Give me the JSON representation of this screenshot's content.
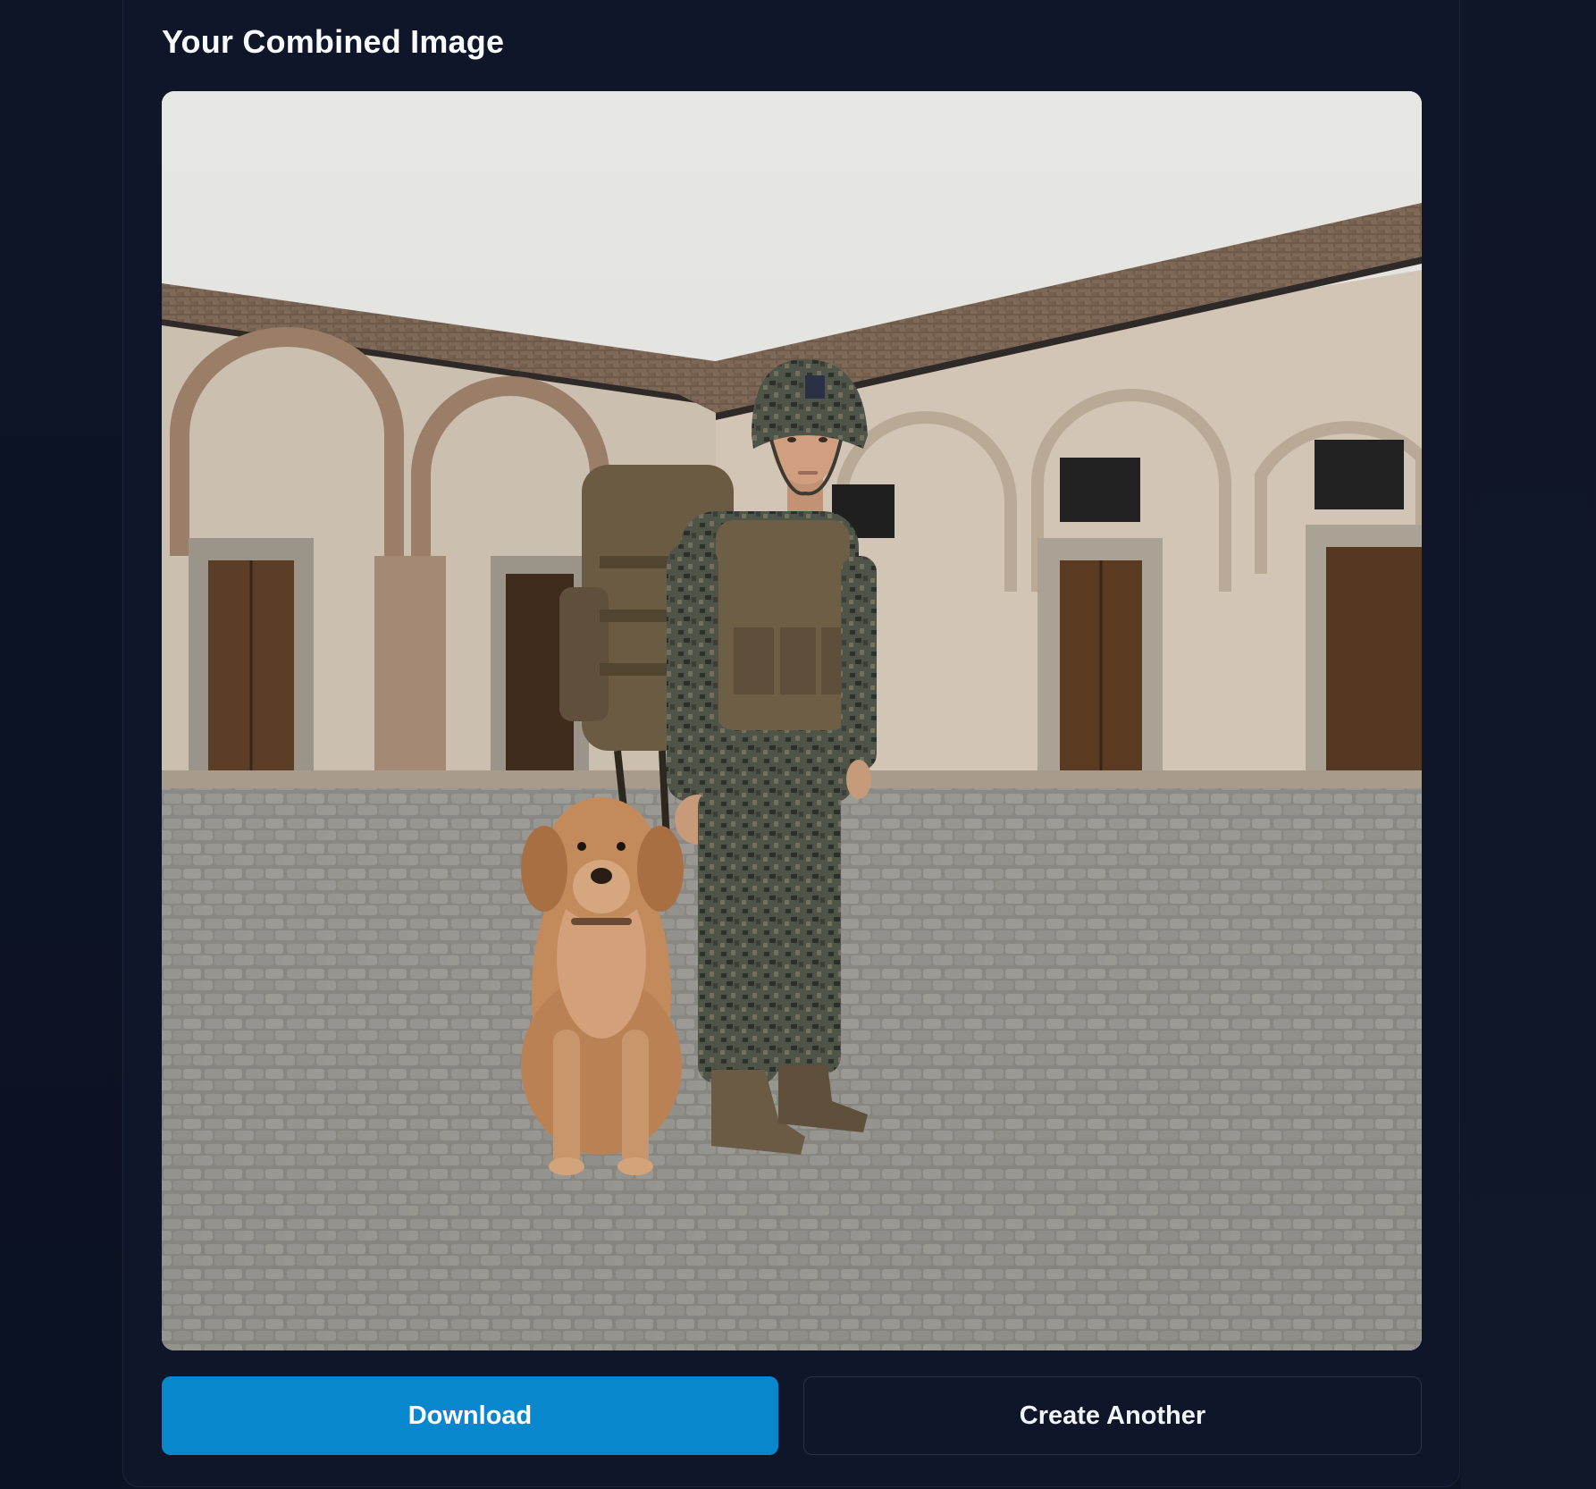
{
  "result": {
    "title": "Your Combined Image",
    "image": {
      "description_icon": "combined-photo",
      "subject": "soldier-with-dog"
    },
    "actions": {
      "download_label": "Download",
      "create_another_label": "Create Another"
    }
  },
  "colors": {
    "page_background": "#0c1323",
    "card_background": "#0f1629",
    "primary_button": "#0887cd",
    "secondary_button_border": "#2a3346",
    "title_text": "#f8fafc"
  }
}
